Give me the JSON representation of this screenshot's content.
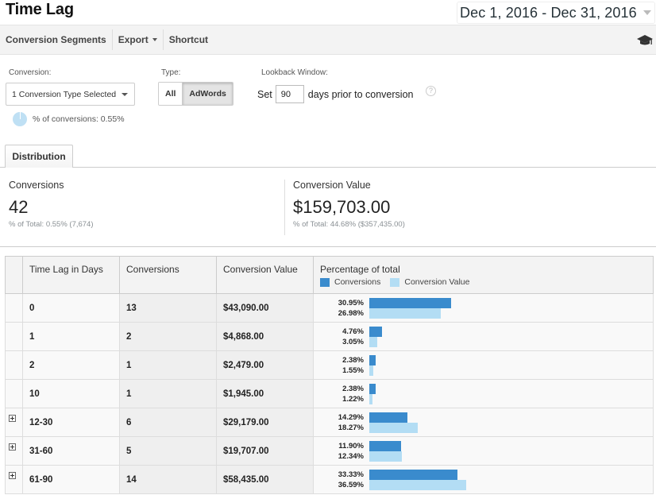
{
  "header": {
    "title": "Time Lag",
    "date_range": "Dec 1, 2016 - Dec 31, 2016"
  },
  "toolbar": {
    "conversion_segments": "Conversion Segments",
    "export": "Export",
    "shortcut": "Shortcut",
    "help_icon": "graduation-cap-icon"
  },
  "controls": {
    "conversion_label": "Conversion:",
    "conversion_selected": "1 Conversion Type Selected",
    "type_label": "Type:",
    "type_options": [
      "All",
      "AdWords"
    ],
    "type_selected": "AdWords",
    "lookback_label": "Lookback Window:",
    "lookback_prefix": "Set",
    "lookback_value": "90",
    "lookback_suffix": "days prior to conversion",
    "help_glyph": "?",
    "pct_conversions": "% of conversions: 0.55%"
  },
  "tabs": [
    {
      "label": "Distribution",
      "active": true
    }
  ],
  "scorecards": [
    {
      "label": "Conversions",
      "value": "42",
      "sub_prefix": "% of Total:",
      "sub_pct": "0.55%",
      "sub_total": "(7,674)"
    },
    {
      "label": "Conversion Value",
      "value": "$159,703.00",
      "sub_prefix": "% of Total:",
      "sub_pct": "44.68%",
      "sub_total": "($357,435.00)"
    }
  ],
  "colors": {
    "conversions_bar": "#3a8bcd",
    "conversion_value_bar": "#b3ddf4"
  },
  "table": {
    "headers": [
      "Time Lag in Days",
      "Conversions",
      "Conversion Value",
      "Percentage of total"
    ],
    "legend": [
      "Conversions",
      "Conversion Value"
    ],
    "rows": [
      {
        "lag": "0",
        "conversions": "13",
        "value": "$43,090.00",
        "pct_conv": "30.95%",
        "pct_val": "26.98%",
        "conv_share": 30.95,
        "val_share": 26.98,
        "expandable": false
      },
      {
        "lag": "1",
        "conversions": "2",
        "value": "$4,868.00",
        "pct_conv": "4.76%",
        "pct_val": "3.05%",
        "conv_share": 4.76,
        "val_share": 3.05,
        "expandable": false
      },
      {
        "lag": "2",
        "conversions": "1",
        "value": "$2,479.00",
        "pct_conv": "2.38%",
        "pct_val": "1.55%",
        "conv_share": 2.38,
        "val_share": 1.55,
        "expandable": false
      },
      {
        "lag": "10",
        "conversions": "1",
        "value": "$1,945.00",
        "pct_conv": "2.38%",
        "pct_val": "1.22%",
        "conv_share": 2.38,
        "val_share": 1.22,
        "expandable": false
      },
      {
        "lag": "12-30",
        "conversions": "6",
        "value": "$29,179.00",
        "pct_conv": "14.29%",
        "pct_val": "18.27%",
        "conv_share": 14.29,
        "val_share": 18.27,
        "expandable": true
      },
      {
        "lag": "31-60",
        "conversions": "5",
        "value": "$19,707.00",
        "pct_conv": "11.90%",
        "pct_val": "12.34%",
        "conv_share": 11.9,
        "val_share": 12.34,
        "expandable": true
      },
      {
        "lag": "61-90",
        "conversions": "14",
        "value": "$58,435.00",
        "pct_conv": "33.33%",
        "pct_val": "36.59%",
        "conv_share": 33.33,
        "val_share": 36.59,
        "expandable": true
      }
    ]
  }
}
